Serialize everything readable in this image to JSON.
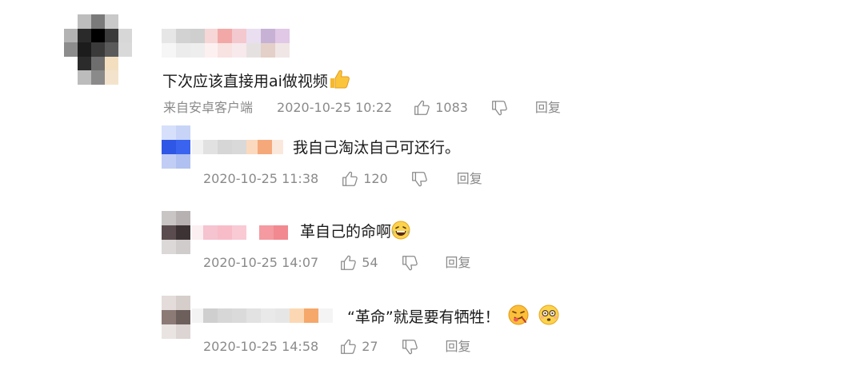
{
  "comments": [
    {
      "text": "下次应该直接用ai做视频",
      "source": "来自安卓客户端",
      "time": "2020-10-25 10:22",
      "likes": "1083",
      "reply": "回复",
      "emoji": "thumbs-up"
    },
    {
      "text": "我自己淘汰自己可还行。",
      "time": "2020-10-25 11:38",
      "likes": "120",
      "reply": "回复"
    },
    {
      "text": "革自己的命啊",
      "time": "2020-10-25 14:07",
      "likes": "54",
      "reply": "回复",
      "emoji": "laughing-tears"
    },
    {
      "text": "“革命”就是要有牺牲！",
      "time": "2020-10-25 14:58",
      "likes": "27",
      "reply": "回复",
      "emoji": "face-tongue, dizzy-face"
    }
  ]
}
